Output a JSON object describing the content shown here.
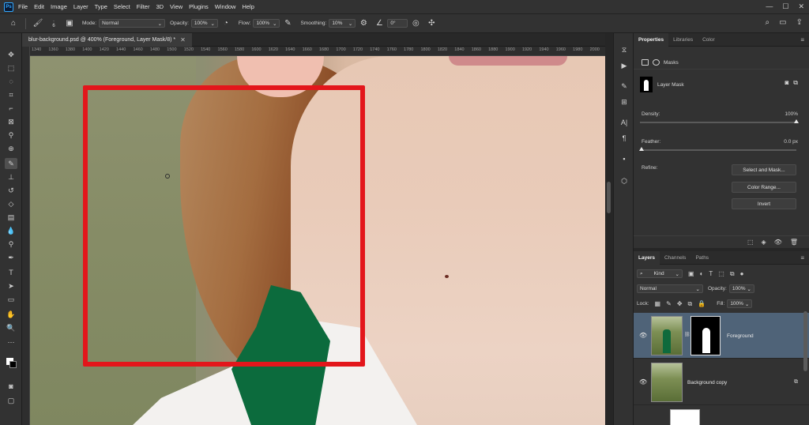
{
  "menu": {
    "items": [
      "File",
      "Edit",
      "Image",
      "Layer",
      "Type",
      "Select",
      "Filter",
      "3D",
      "View",
      "Plugins",
      "Window",
      "Help"
    ]
  },
  "window_controls": {
    "minimize": "—",
    "maximize": "☐",
    "close": "✕"
  },
  "options": {
    "brush_size": "6",
    "mode_label": "Mode:",
    "mode_value": "Normal",
    "opacity_label": "Opacity:",
    "opacity_value": "100%",
    "flow_label": "Flow:",
    "flow_value": "100%",
    "smoothing_label": "Smoothing:",
    "smoothing_value": "10%",
    "angle_value": "0°"
  },
  "document": {
    "tab_title": "blur-background.psd @ 400% (Foreground, Layer Mask/8) *",
    "close_glyph": "✕"
  },
  "ruler": {
    "ticks": [
      "1340",
      "1360",
      "1380",
      "1400",
      "1420",
      "1440",
      "1460",
      "1480",
      "1500",
      "1520",
      "1540",
      "1560",
      "1580",
      "1600",
      "1620",
      "1640",
      "1660",
      "1680",
      "1700",
      "1720",
      "1740",
      "1760",
      "1780",
      "1800",
      "1820",
      "1840",
      "1860",
      "1880",
      "1900",
      "1920",
      "1940",
      "1960",
      "1980",
      "2000"
    ]
  },
  "properties": {
    "tabs": [
      "Properties",
      "Libraries",
      "Color"
    ],
    "masks_label": "Masks",
    "layer_mask_label": "Layer Mask",
    "density_label": "Density:",
    "density_value": "100%",
    "density_fraction": 1.0,
    "feather_label": "Feather:",
    "feather_value": "0.0 px",
    "feather_fraction": 0.0,
    "refine_label": "Refine:",
    "select_and_mask": "Select and Mask...",
    "color_range": "Color Range...",
    "invert": "Invert"
  },
  "layers_panel": {
    "tabs": [
      "Layers",
      "Channels",
      "Paths"
    ],
    "filter_kind": "Kind",
    "blend_mode": "Normal",
    "opacity_label": "Opacity:",
    "opacity_value": "100%",
    "lock_label": "Lock:",
    "fill_label": "Fill:",
    "fill_value": "100%",
    "layers": [
      {
        "name": "Foreground",
        "selected": true
      },
      {
        "name": "Background copy",
        "selected": false
      }
    ]
  },
  "colors": {
    "highlight_box": "#e3161b",
    "selected_layer": "#4f6378",
    "ps_blue": "#31a8ff"
  }
}
